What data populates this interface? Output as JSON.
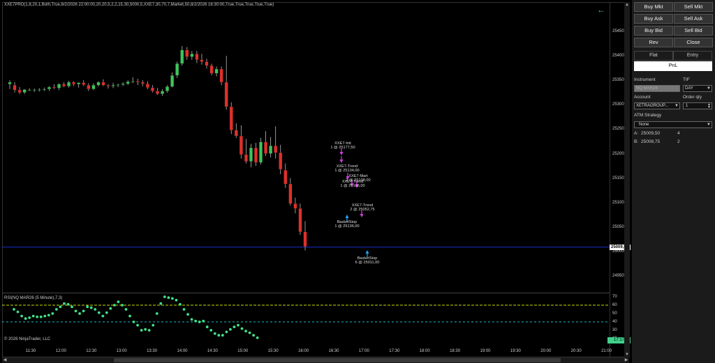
{
  "chart": {
    "indicator_label": "XXE7PRO(1,8,20,1,Both,True,8/2/2026 22:00:00,20,20,5,2,2,15,30,5000,5,XXE7,30,70,7,Market,50,8/2/2026 16:30:00,True,True,True,True,True)",
    "rsi_label": "RSI(NQ MAR26 (5 Minute),7,3)",
    "copyright": "© 2026 NinjaTrader, LLC",
    "time_labels": [
      "11:30",
      "12:00",
      "12:30",
      "13:00",
      "13:30",
      "14:00",
      "14:30",
      "15:00",
      "15:30",
      "16:00",
      "16:30",
      "17:00",
      "17:30",
      "18:00",
      "18:30",
      "19:00",
      "19:30",
      "20:00",
      "20:30",
      "21:00"
    ],
    "price_labels": [
      "25450,00",
      "25400,00",
      "25350,00",
      "25300,00",
      "25250,00",
      "25200,00",
      "25150,00",
      "25100,00",
      "25050,00",
      "25000,00",
      "24950,00"
    ],
    "rsi_labels": [
      "70",
      "60",
      "50",
      "40",
      "30",
      "20"
    ],
    "current_price": "25009,00",
    "current_time": "17:17",
    "up_color": "#3fc45a",
    "down_color": "#e0302a",
    "price_line_color": "#1a2fc8",
    "rsi_line_upper_color": "#c8e000",
    "rsi_line_lower_color": "#20b8c8",
    "rsi_dot_color": "#3fe08a"
  },
  "trade_labels": [
    {
      "name": "trade-label-xxe7-init",
      "line1": "XXE7-Init",
      "line2": "1 @ 25177,50"
    },
    {
      "name": "trade-label-xxe7-trend-1",
      "line1": "XXE7-Trend",
      "line2": "1 @ 25134,00"
    },
    {
      "name": "trade-label-xxe7-mart",
      "line1": "XXE7-Mart",
      "line2": "2 @ 25108,00"
    },
    {
      "name": "trade-label-overlap",
      "line1": "XXE7-Trend",
      "line2": "1 @ 25106,00"
    },
    {
      "name": "trade-label-xxe7-trend-2",
      "line1": "XXE7-Trend",
      "line2": "2 @ 25052,75"
    },
    {
      "name": "trade-label-basketstop-1",
      "line1": "BasketStop",
      "line2": "1 @ 25136,00"
    },
    {
      "name": "trade-label-basketstop-2",
      "line1": "BasketStop",
      "line2": "6 @ 25011,00"
    }
  ],
  "panel": {
    "buy_mkt": "Buy Mkt",
    "sell_mkt": "Sell Mkt",
    "buy_ask": "Buy Ask",
    "sell_ask": "Sell Ask",
    "buy_bid": "Buy Bid",
    "sell_bid": "Sell Bid",
    "rev": "Rev",
    "close": "Close",
    "flat": "Flat",
    "entry": "Entry",
    "pnl": "PnL",
    "instrument_label": "Instrument",
    "instrument_value": "NQ MAR26",
    "tif_label": "TIF",
    "tif_value": "DAY",
    "account_label": "Account",
    "account_value": "XETRAGROUP...",
    "order_qty_label": "Order qty",
    "order_qty_value": "1",
    "atm_label": "ATM Strategy",
    "atm_value": "None",
    "ask_label": "A:",
    "ask_price": "25009,50",
    "ask_size": "4",
    "bid_label": "B:",
    "bid_price": "25008,75",
    "bid_size": "2"
  }
}
